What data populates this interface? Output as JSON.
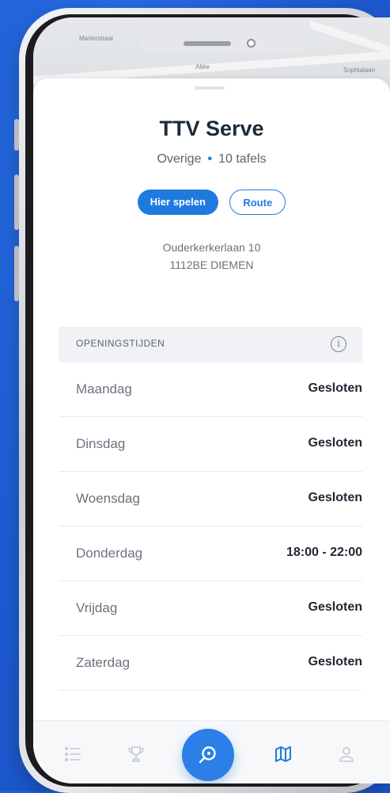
{
  "map": {
    "labels": [
      "Marterstraat",
      "Allée",
      "Sophialaan"
    ]
  },
  "venue": {
    "name": "TTV Serve",
    "category": "Overige",
    "separator": "•",
    "tables": "10 tafels",
    "address_line1": "Ouderkerkerlaan 10",
    "address_line2": "1112BE DIEMEN"
  },
  "actions": {
    "play_label": "Hier spelen",
    "route_label": "Route"
  },
  "opening_hours": {
    "header": "OPENINGSTIJDEN",
    "info_icon": "info-icon",
    "rows": [
      {
        "day": "Maandag",
        "time": "Gesloten"
      },
      {
        "day": "Dinsdag",
        "time": "Gesloten"
      },
      {
        "day": "Woensdag",
        "time": "Gesloten"
      },
      {
        "day": "Donderdag",
        "time": "18:00 - 22:00"
      },
      {
        "day": "Vrijdag",
        "time": "Gesloten"
      },
      {
        "day": "Zaterdag",
        "time": "Gesloten"
      }
    ]
  },
  "tabbar": {
    "items": [
      "list-icon",
      "trophy-icon",
      "ping-pong-search-icon",
      "map-icon",
      "profile-icon"
    ],
    "active": "map-icon"
  },
  "colors": {
    "accent": "#1f7ae0",
    "background": "#1f5fd8",
    "title": "#1d2a3a"
  }
}
